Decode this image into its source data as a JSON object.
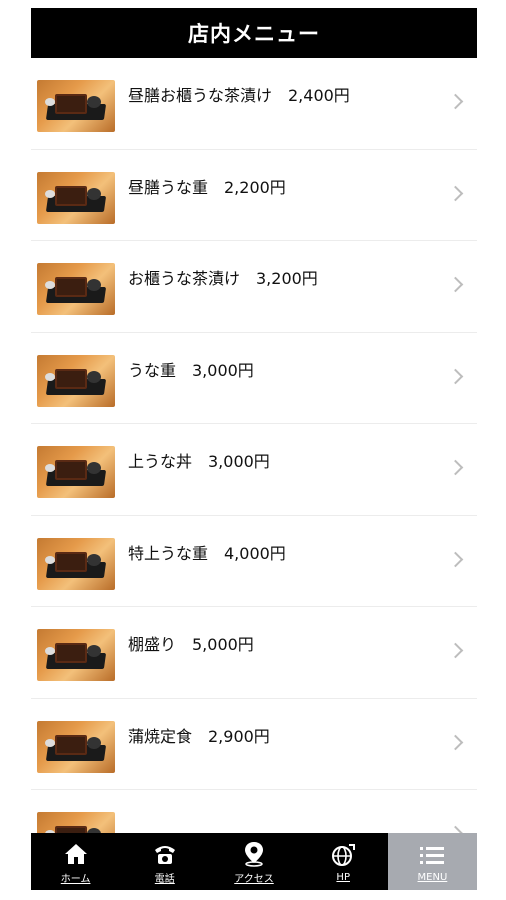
{
  "header": {
    "title": "店内メニュー"
  },
  "menu_items": [
    {
      "label": "昼膳お櫃うな茶漬け　2,400円"
    },
    {
      "label": "昼膳うな重　2,200円"
    },
    {
      "label": "お櫃うな茶漬け　3,200円"
    },
    {
      "label": "うな重　3,000円"
    },
    {
      "label": "上うな丼　3,000円"
    },
    {
      "label": "特上うな重　4,000円"
    },
    {
      "label": "棚盛り　5,000円"
    },
    {
      "label": "蒲焼定食　2,900円"
    },
    {
      "label": ""
    }
  ],
  "tabbar": {
    "active_color": "#a7aab0",
    "tabs": [
      {
        "label": "ホーム",
        "icon": "home-icon"
      },
      {
        "label": "電話",
        "icon": "phone-icon"
      },
      {
        "label": "アクセス",
        "icon": "map-pin-icon"
      },
      {
        "label": "HP",
        "icon": "globe-icon"
      },
      {
        "label": "MENU",
        "icon": "menu-icon"
      }
    ]
  }
}
